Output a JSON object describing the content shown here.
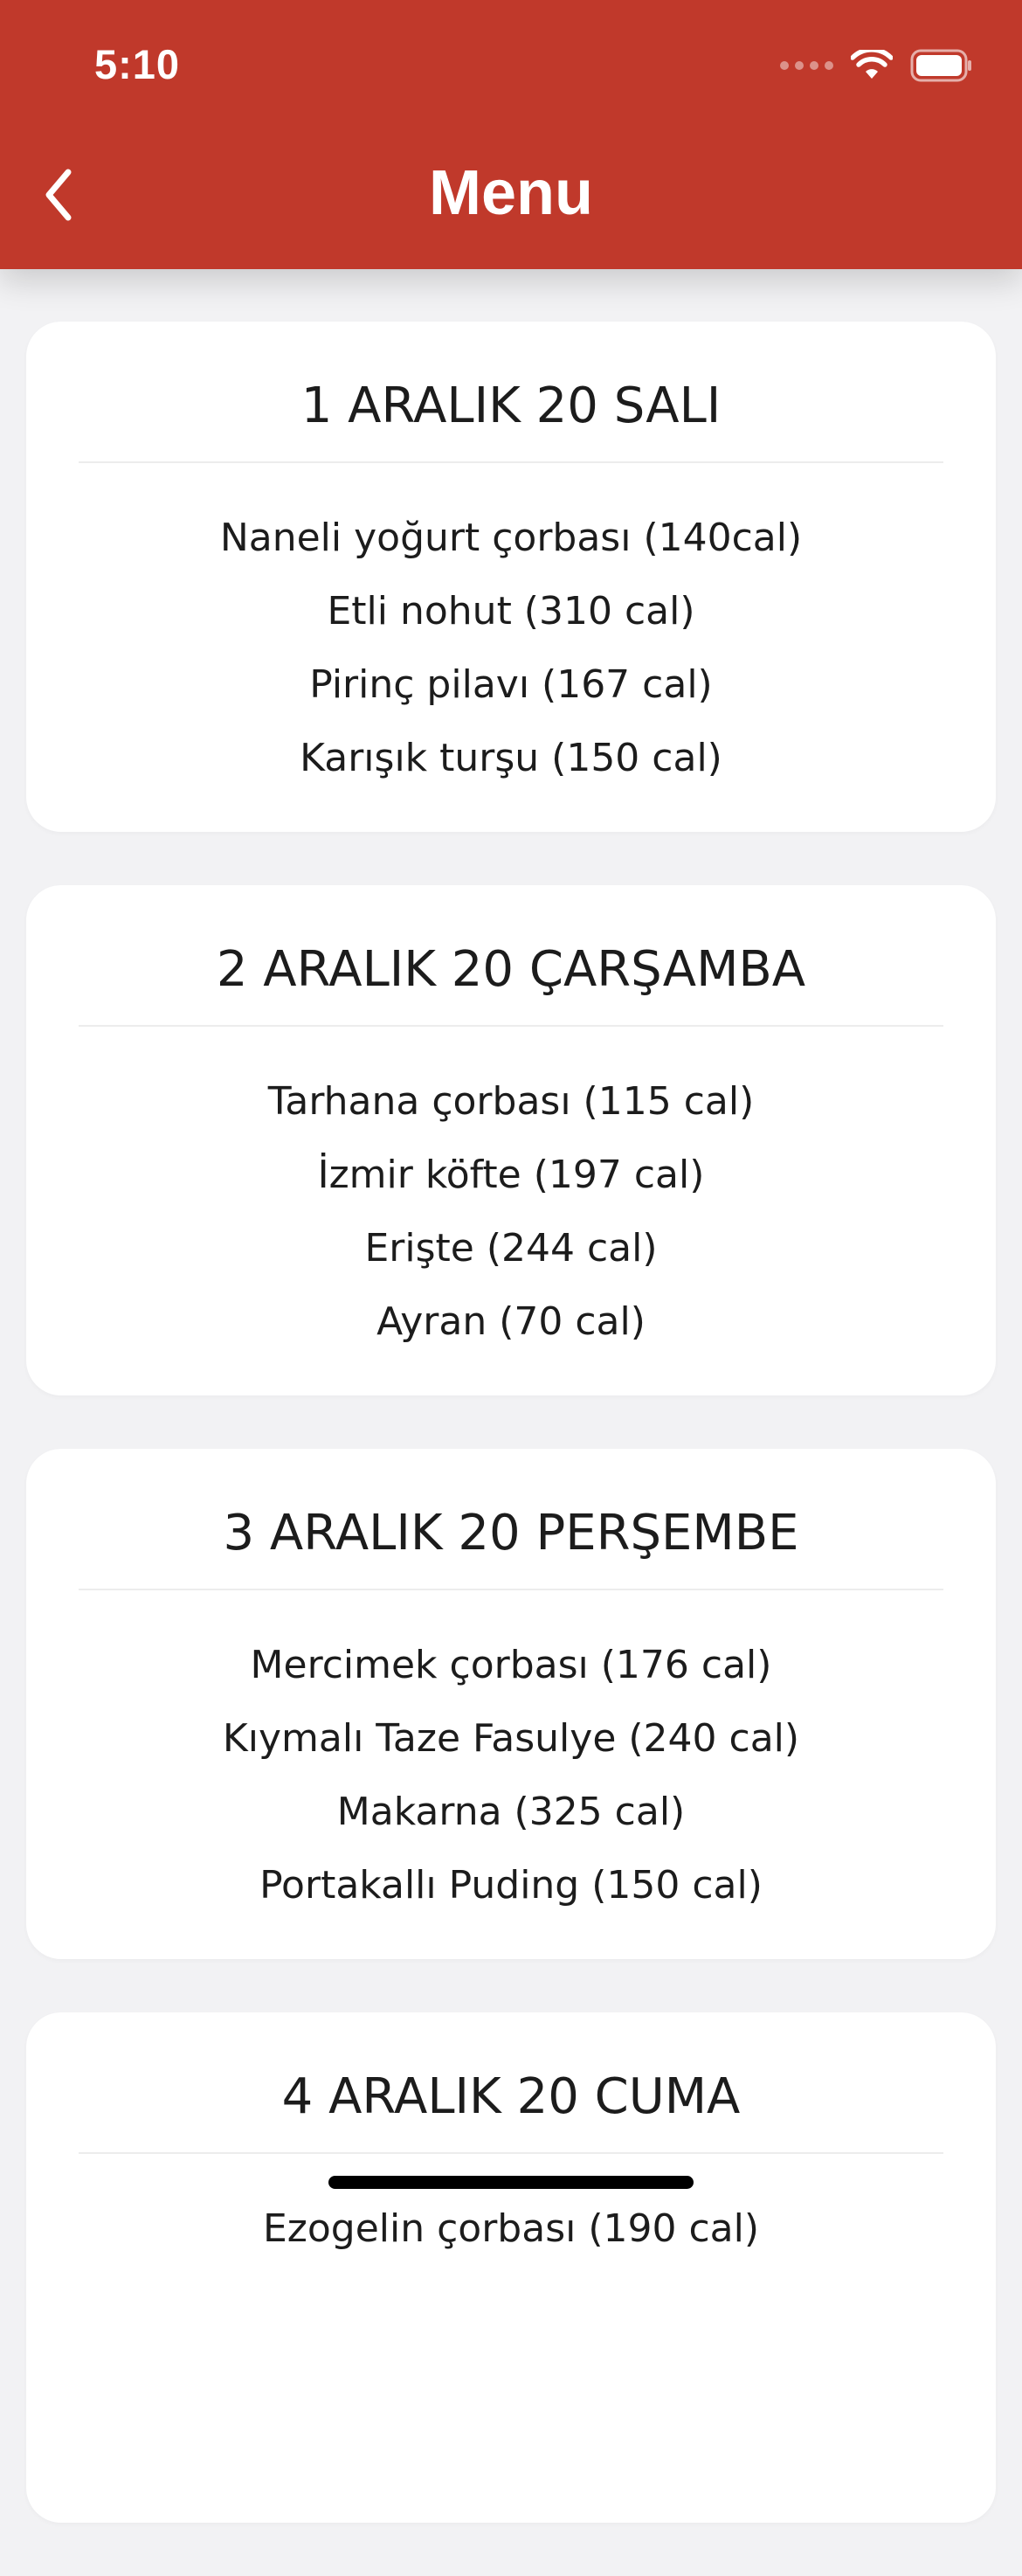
{
  "status_bar": {
    "time": "5:10"
  },
  "header": {
    "title": "Menu",
    "back_icon": "chevron-left-icon",
    "background": "#c0392b"
  },
  "menu_days": [
    {
      "date": "1 ARALIK 20 SALI",
      "items": [
        "Naneli yoğurt çorbası (140cal)",
        "Etli nohut (310 cal)",
        "Pirinç pilavı (167 cal)",
        "Karışık turşu (150 cal)"
      ]
    },
    {
      "date": "2 ARALIK 20 ÇARŞAMBA",
      "items": [
        "Tarhana çorbası (115 cal)",
        "İzmir köfte (197 cal)",
        "Erişte (244 cal)",
        "Ayran (70 cal)"
      ]
    },
    {
      "date": "3 ARALIK 20 PERŞEMBE",
      "items": [
        "Mercimek çorbası (176 cal)",
        "Kıymalı Taze Fasulye (240 cal)",
        "Makarna (325 cal)",
        "Portakallı Puding (150 cal)"
      ]
    },
    {
      "date": "4 ARALIK 20 CUMA",
      "items": [
        "Ezogelin çorbası (190 cal)"
      ]
    }
  ]
}
